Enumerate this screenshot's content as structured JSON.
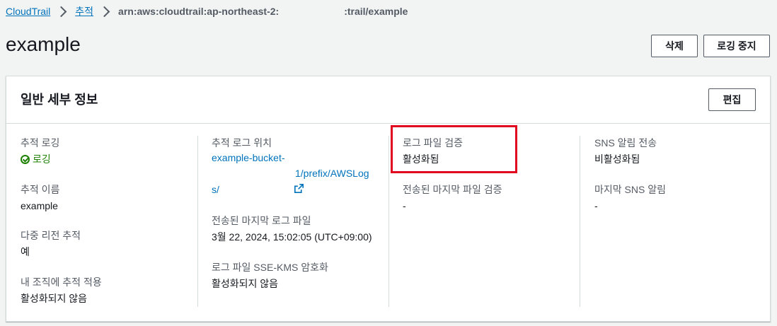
{
  "breadcrumb": {
    "root": "CloudTrail",
    "trails": "추적",
    "current_prefix": "arn:aws:cloudtrail:ap-northeast-2:",
    "current_suffix": ":trail/example"
  },
  "page": {
    "title": "example"
  },
  "actions": {
    "delete_label": "삭제",
    "stop_logging_label": "로깅 중지"
  },
  "card": {
    "title": "일반 세부 정보",
    "edit_label": "편집",
    "col1": {
      "trail_logging_label": "추적 로깅",
      "trail_logging_value": "로깅",
      "trail_name_label": "추적 이름",
      "trail_name_value": "example",
      "multi_region_label": "다중 리전 추적",
      "multi_region_value": "예",
      "org_trail_label": "내 조직에 추적 적용",
      "org_trail_value": "활성화되지 않음"
    },
    "col2": {
      "log_location_label": "추적 로그 위치",
      "log_location_line1": "example-bucket-",
      "log_location_line2": "1/prefix/AWSLog",
      "log_location_line3": "s/",
      "last_log_label": "전송된 마지막 로그 파일",
      "last_log_value": "3월 22, 2024, 15:02:05 (UTC+09:00)",
      "sse_kms_label": "로그 파일 SSE-KMS 암호화",
      "sse_kms_value": "활성화되지 않음"
    },
    "col3": {
      "validation_label": "로그 파일 검증",
      "validation_value": "활성화됨",
      "last_digest_label": "전송된 마지막 파일 검증",
      "last_digest_value": "-"
    },
    "col4": {
      "sns_label": "SNS 알림 전송",
      "sns_value": "비활성화됨",
      "last_sns_label": "마지막 SNS 알림",
      "last_sns_value": "-"
    }
  },
  "icons": {
    "status": "check-circle-icon",
    "external": "external-link-icon"
  },
  "colors": {
    "link": "#0073bb",
    "success": "#1d8102",
    "highlight": "#e0041f"
  }
}
